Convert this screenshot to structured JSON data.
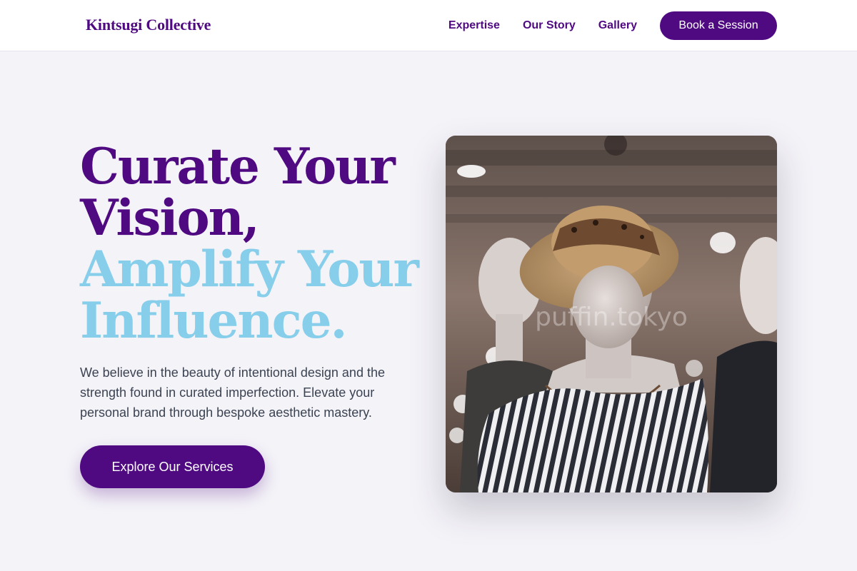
{
  "header": {
    "brand": "Kintsugi Collective",
    "nav": [
      "Expertise",
      "Our Story",
      "Gallery"
    ],
    "cta_label": "Book a Session"
  },
  "hero": {
    "title_line1": "Curate Your",
    "title_line2": "Vision,",
    "title_line3": "Amplify Your",
    "title_line4": "Influence.",
    "description": "We believe in the beauty of intentional design and the strength found in curated imperfection. Elevate your personal brand through bespoke aesthetic mastery.",
    "button_label": "Explore Our Services",
    "image_watermark": "puffin.tokyo"
  },
  "colors": {
    "primary": "#4f0a82",
    "accent": "#87ceeb",
    "background": "#f4f3f8",
    "text": "#3b4352"
  }
}
